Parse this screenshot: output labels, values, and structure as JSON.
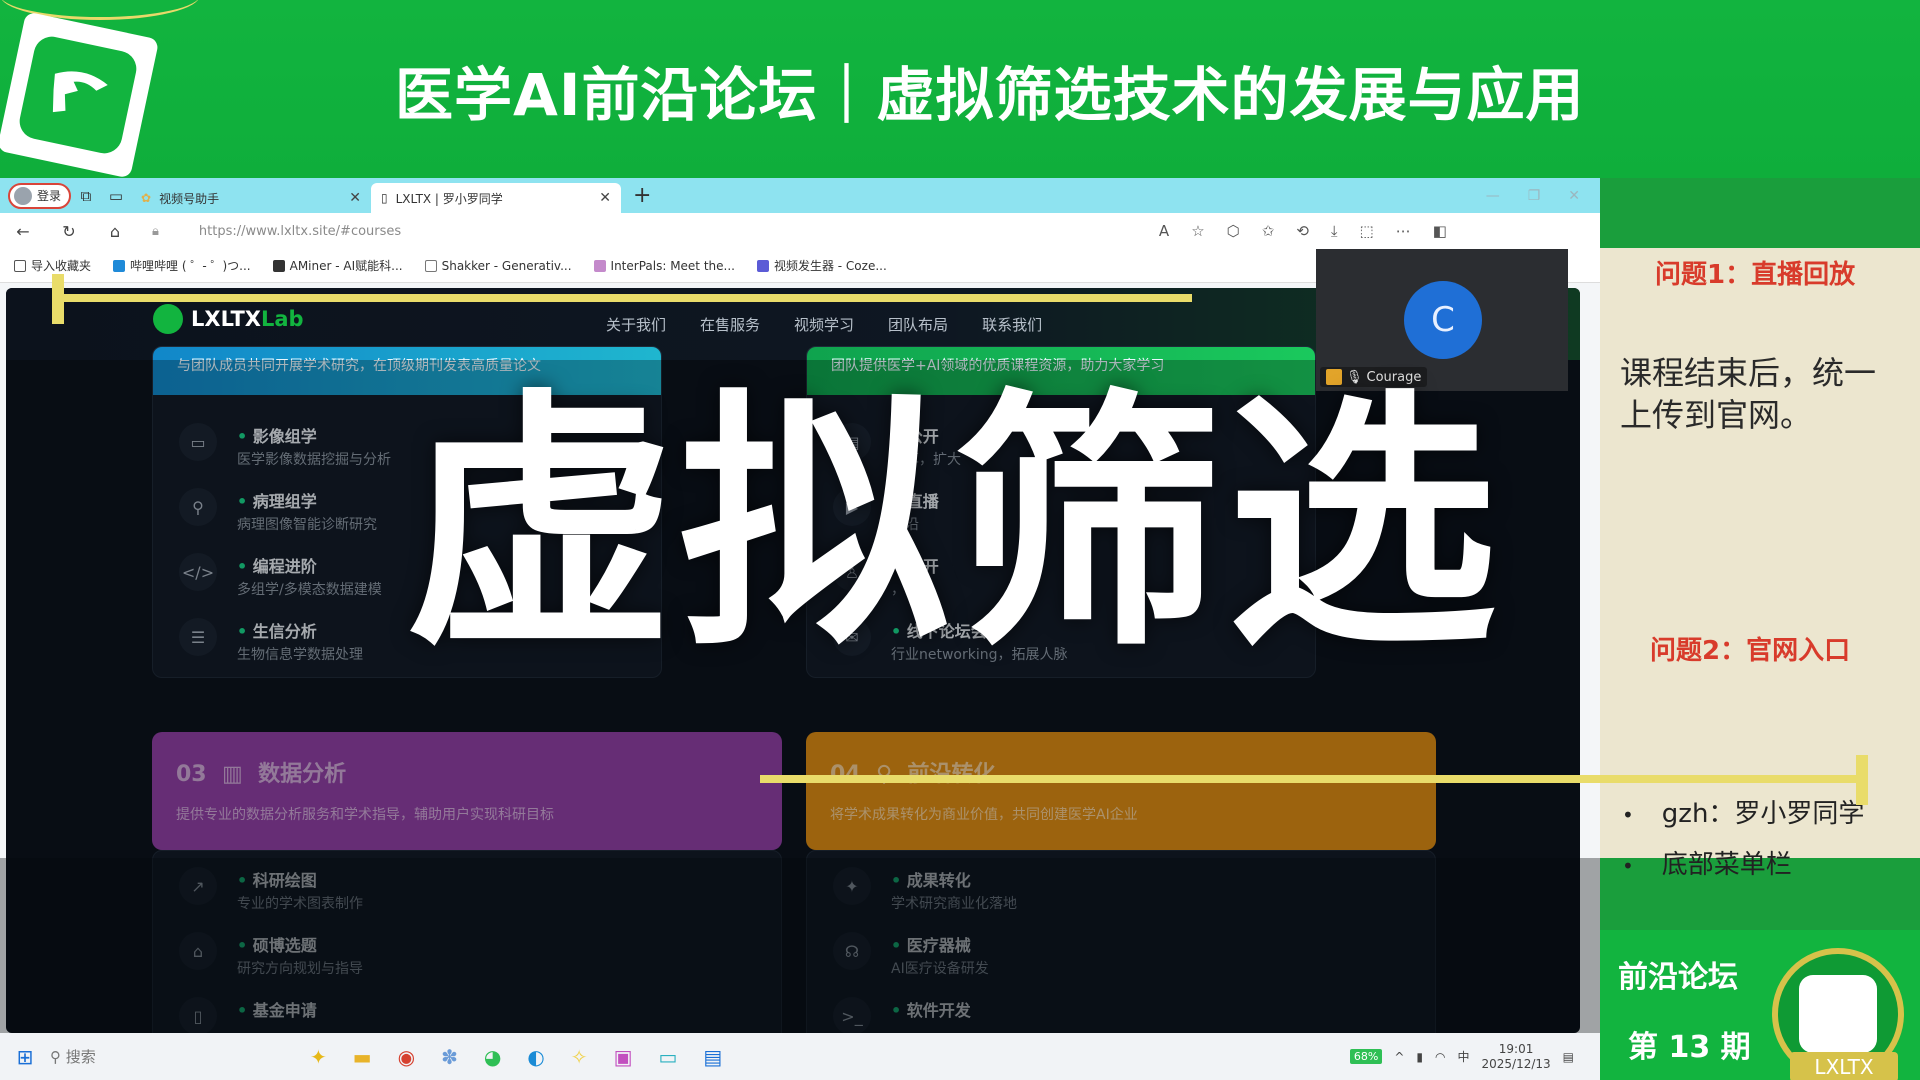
{
  "banner": {
    "title": "医学AI前沿论坛｜虚拟筛选技术的发展与应用"
  },
  "overlay": {
    "big_title": "虚拟筛选"
  },
  "browser": {
    "login_label": "登录",
    "tabs": [
      {
        "label": "视频号助手",
        "active": false
      },
      {
        "label": "LXLTX | 罗小罗同学",
        "active": true
      }
    ],
    "address": "https://www.lxltx.site/#courses",
    "bookmarks": [
      "导入收藏夹",
      "哔哩哔哩 ( ゜- ゜)つ...",
      "AMiner - AI赋能科...",
      "Shakker - Generativ...",
      "InterPals: Meet the...",
      "视频发生器 - Coze..."
    ]
  },
  "site": {
    "brand_main": "LXLTX",
    "brand_accent": "Lab",
    "menu": [
      "关于我们",
      "在售服务",
      "视频学习",
      "团队布局",
      "联系我们"
    ],
    "card1": {
      "head": "与团队成员共同开展学术研究，在顶级期刊发表高质量论文",
      "items": [
        {
          "title": "影像组学",
          "desc": "医学影像数据挖掘与分析",
          "icon": "monitor-icon"
        },
        {
          "title": "病理组学",
          "desc": "病理图像智能诊断研究",
          "icon": "microscope-icon"
        },
        {
          "title": "编程进阶",
          "desc": "多组学/多模态数据建模",
          "icon": "code-icon"
        },
        {
          "title": "生信分析",
          "desc": "生物信息学数据处理",
          "icon": "database-icon"
        }
      ]
    },
    "card2": {
      "head": "团队提供医学+AI领域的优质课程资源，助力大家学习",
      "items": [
        {
          "title": "公开",
          "desc": "分享，扩大",
          "icon": "book-icon"
        },
        {
          "title": "直播",
          "desc": "前沿",
          "icon": "camera-icon"
        },
        {
          "title": "公开",
          "desc": "，增加",
          "icon": "users-icon"
        },
        {
          "title": "线下论坛会",
          "desc": "行业networking，拓展人脉",
          "icon": "chat-icon"
        }
      ]
    },
    "card3": {
      "num": "03",
      "title": "数据分析",
      "desc": "提供专业的数据分析服务和学术指导，辅助用户实现科研目标",
      "items": [
        {
          "title": "科研绘图",
          "desc": "专业的学术图表制作",
          "icon": "trend-icon"
        },
        {
          "title": "硕博选题",
          "desc": "研究方向规划与指导",
          "icon": "graduation-cap-icon"
        },
        {
          "title": "基金申请",
          "desc": "",
          "icon": "document-icon"
        }
      ]
    },
    "card4": {
      "num": "04",
      "title": "前沿转化",
      "desc": "将学术成果转化为商业价值，共同创建医学AI企业",
      "items": [
        {
          "title": "成果转化",
          "desc": "学术研究商业化落地",
          "icon": "sparkle-icon"
        },
        {
          "title": "医疗器械",
          "desc": "AI医疗设备研发",
          "icon": "stethoscope-icon"
        },
        {
          "title": "软件开发",
          "desc": "",
          "icon": "terminal-icon"
        }
      ]
    }
  },
  "video": {
    "avatar_letter": "C",
    "participant": "Courage"
  },
  "right_panel": {
    "q1": "问题1：直播回放",
    "a1": "课程结束后，统一上传到官网。",
    "q2": "问题2：官网入口",
    "bullets": [
      "gzh：罗小罗同学",
      "底部菜单栏"
    ]
  },
  "badge": {
    "line1": "前沿论坛",
    "line2": "第 13 期",
    "logo_text": "LXLTX"
  },
  "taskbar": {
    "search_placeholder": "搜索",
    "battery": "68%",
    "time": "19:01",
    "date": "2025/12/13"
  },
  "colors": {
    "brand_green": "#12b43f",
    "accent_yellow": "#e9dc6a",
    "question_red": "#d83b2b",
    "card3_purple": "#8e3fa3",
    "card4_orange": "#d98a14"
  }
}
